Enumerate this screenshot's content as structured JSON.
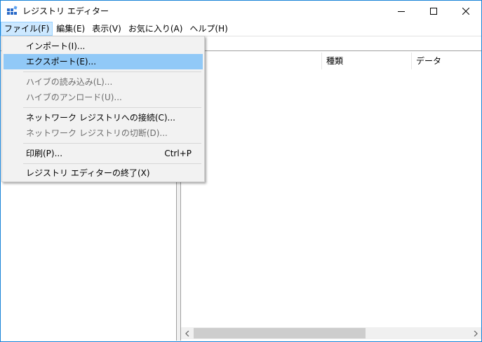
{
  "window": {
    "title": "レジストリ エディター"
  },
  "menubar": {
    "items": [
      {
        "label": "ファイル(F)"
      },
      {
        "label": "編集(E)"
      },
      {
        "label": "表示(V)"
      },
      {
        "label": "お気に入り(A)"
      },
      {
        "label": "ヘルプ(H)"
      }
    ]
  },
  "file_menu": {
    "import": "インポート(I)...",
    "export": "エクスポート(E)...",
    "load_hive": "ハイブの読み込み(L)...",
    "unload_hive": "ハイブのアンロード(U)...",
    "connect_network": "ネットワーク レジストリへの接続(C)...",
    "disconnect_network": "ネットワーク レジストリの切断(D)...",
    "print": "印刷(P)...",
    "print_shortcut": "Ctrl+P",
    "exit": "レジストリ エディターの終了(X)"
  },
  "list": {
    "columns": {
      "type": "種類",
      "data": "データ"
    }
  },
  "colors": {
    "highlight": "#91c9f7",
    "menu_active": "#cce8ff",
    "window_border": "#1883d7"
  }
}
